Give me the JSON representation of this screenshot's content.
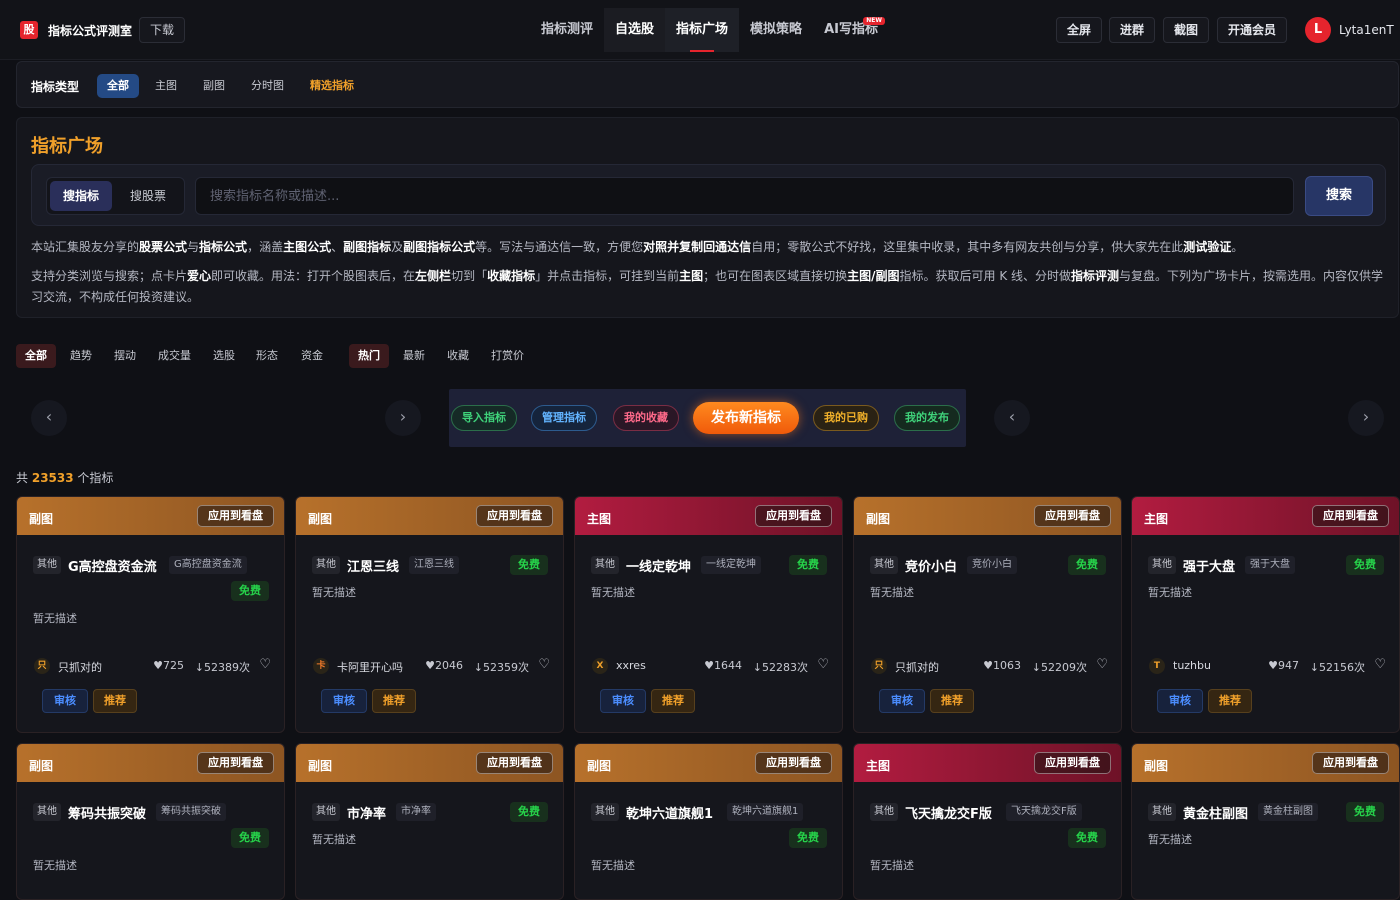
{
  "header": {
    "logo_char": "股",
    "title": "指标公式评测室",
    "download_label": "下载",
    "nav": [
      {
        "label": "指标测评",
        "state": "normal"
      },
      {
        "label": "自选股",
        "state": "boxed"
      },
      {
        "label": "指标广场",
        "state": "active"
      },
      {
        "label": "模拟策略",
        "state": "normal"
      },
      {
        "label": "AI写指标",
        "state": "normal",
        "badge": "NEW"
      }
    ],
    "buttons": [
      "全屏",
      "进群",
      "截图",
      "开通会员"
    ],
    "user": {
      "avatar": "L",
      "name": "Lyta1enT"
    }
  },
  "type_filter": {
    "label": "指标类型",
    "tabs": [
      {
        "label": "全部",
        "state": "active"
      },
      {
        "label": "主图",
        "state": "normal"
      },
      {
        "label": "副图",
        "state": "normal"
      },
      {
        "label": "分时图",
        "state": "normal"
      },
      {
        "label": "精选指标",
        "state": "orange"
      }
    ]
  },
  "intro": {
    "title": "指标广场",
    "search_modes": [
      "搜指标",
      "搜股票"
    ],
    "search_placeholder": "搜索指标名称或描述...",
    "search_value": "",
    "search_button": "搜索",
    "line1": [
      {
        "t": "本站汇集股友分享的"
      },
      {
        "t": "股票公式",
        "b": true
      },
      {
        "t": "与"
      },
      {
        "t": "指标公式",
        "b": true
      },
      {
        "t": "，涵盖"
      },
      {
        "t": "主图公式",
        "b": true
      },
      {
        "t": "、"
      },
      {
        "t": "副图指标",
        "b": true
      },
      {
        "t": "及"
      },
      {
        "t": "副图指标公式",
        "b": true
      },
      {
        "t": "等。写法与通达信一致，方便您"
      },
      {
        "t": "对照并复制回通达信",
        "b": true
      },
      {
        "t": "自用；零散公式不好找，这里集中收录，其中多有网友共创与分享，供大家先在此"
      },
      {
        "t": "测试验证",
        "b": true
      },
      {
        "t": "。"
      }
    ],
    "line2": [
      {
        "t": "支持分类浏览与搜索；点卡片"
      },
      {
        "t": "爱心",
        "b": true
      },
      {
        "t": "即可收藏。用法：打开个股图表后，在"
      },
      {
        "t": "左侧栏",
        "b": true
      },
      {
        "t": "切到「"
      },
      {
        "t": "收藏指标",
        "b": true
      },
      {
        "t": "」并点击指标，可挂到当前"
      },
      {
        "t": "主图",
        "b": true
      },
      {
        "t": "；也可在图表区域直接切换"
      },
      {
        "t": "主图/副图",
        "b": true
      },
      {
        "t": "指标。获取后可用 K 线、分时做"
      },
      {
        "t": "指标评测",
        "b": true
      },
      {
        "t": "与复盘。下列为广场卡片，按需选用。内容仅供学习交流，不构成任何投资建议。"
      }
    ]
  },
  "categories": [
    {
      "label": "全部",
      "active": true
    },
    {
      "label": "趋势",
      "active": false
    },
    {
      "label": "摆动",
      "active": false
    },
    {
      "label": "成交量",
      "active": false
    },
    {
      "label": "选股",
      "active": false
    },
    {
      "label": "形态",
      "active": false
    },
    {
      "label": "资金",
      "active": false
    }
  ],
  "sorts": [
    {
      "label": "热门",
      "active": true
    },
    {
      "label": "最新",
      "active": false
    },
    {
      "label": "收藏",
      "active": false
    },
    {
      "label": "打赏价",
      "active": false
    }
  ],
  "actions": {
    "import": "导入指标",
    "manage": "管理指标",
    "favorites": "我的收藏",
    "publish": "发布新指标",
    "bought": "我的已购",
    "published": "我的发布"
  },
  "arrows": {
    "left": "‹",
    "right": "›"
  },
  "colors": {
    "accent_orange": "#f0a02a",
    "brand_red": "#e5242d",
    "free_green": "#26d24a",
    "audit_blue": "#4b8dff"
  },
  "count": {
    "prefix": "共",
    "number": "23533",
    "suffix": "个指标"
  },
  "card_labels": {
    "apply": "应用到看盘",
    "other": "其他",
    "audit": "审核",
    "recommend": "推荐",
    "free": "免费",
    "heart": "♡"
  },
  "cards": [
    {
      "type": "副图",
      "style": "fu",
      "name": "G高控盘资金流",
      "alias": "G高控盘资金流",
      "free_below": true,
      "desc": "暂无描述",
      "author": "只抓对的",
      "author_avatar": "只",
      "avatar_color": "#f0a02a",
      "likes": "♥725",
      "downloads": "↓52389次"
    },
    {
      "type": "副图",
      "style": "fu",
      "name": "江恩三线",
      "alias": "江恩三线",
      "free_below": false,
      "desc": "暂无描述",
      "author": "卡阿里开心吗",
      "author_avatar": "卡",
      "avatar_color": "#f07a2a",
      "likes": "♥2046",
      "downloads": "↓52359次"
    },
    {
      "type": "主图",
      "style": "zhu",
      "name": "一线定乾坤",
      "alias": "一线定乾坤",
      "free_below": false,
      "desc": "暂无描述",
      "author": "xxres",
      "author_avatar": "X",
      "avatar_color": "#f0a02a",
      "likes": "♥1644",
      "downloads": "↓52283次"
    },
    {
      "type": "副图",
      "style": "fu",
      "name": "竞价小白",
      "alias": "竞价小白",
      "free_below": false,
      "desc": "暂无描述",
      "author": "只抓对的",
      "author_avatar": "只",
      "avatar_color": "#f0a02a",
      "likes": "♥1063",
      "downloads": "↓52209次"
    },
    {
      "type": "主图",
      "style": "zhu",
      "name": "强于大盘",
      "alias": "强于大盘",
      "free_below": false,
      "desc": "暂无描述",
      "author": "tuzhbu",
      "author_avatar": "T",
      "avatar_color": "#f0a02a",
      "likes": "♥947",
      "downloads": "↓52156次"
    },
    {
      "type": "副图",
      "style": "fu",
      "name": "筹码共振突破",
      "alias": "筹码共振突破",
      "free_below": true,
      "desc": "暂无描述"
    },
    {
      "type": "副图",
      "style": "fu",
      "name": "市净率",
      "alias": "市净率",
      "free_below": false,
      "desc": "暂无描述"
    },
    {
      "type": "副图",
      "style": "fu",
      "name": "乾坤六道旗舰1",
      "alias": "乾坤六道旗舰1",
      "free_below": true,
      "desc": "暂无描述"
    },
    {
      "type": "主图",
      "style": "zhu",
      "name": "飞天擒龙交F版",
      "alias": "飞天擒龙交F版",
      "free_below": true,
      "desc": "暂无描述"
    },
    {
      "type": "副图",
      "style": "fu",
      "name": "黄金柱副图",
      "alias": "黄金柱副图",
      "free_below": false,
      "desc": "暂无描述"
    }
  ]
}
